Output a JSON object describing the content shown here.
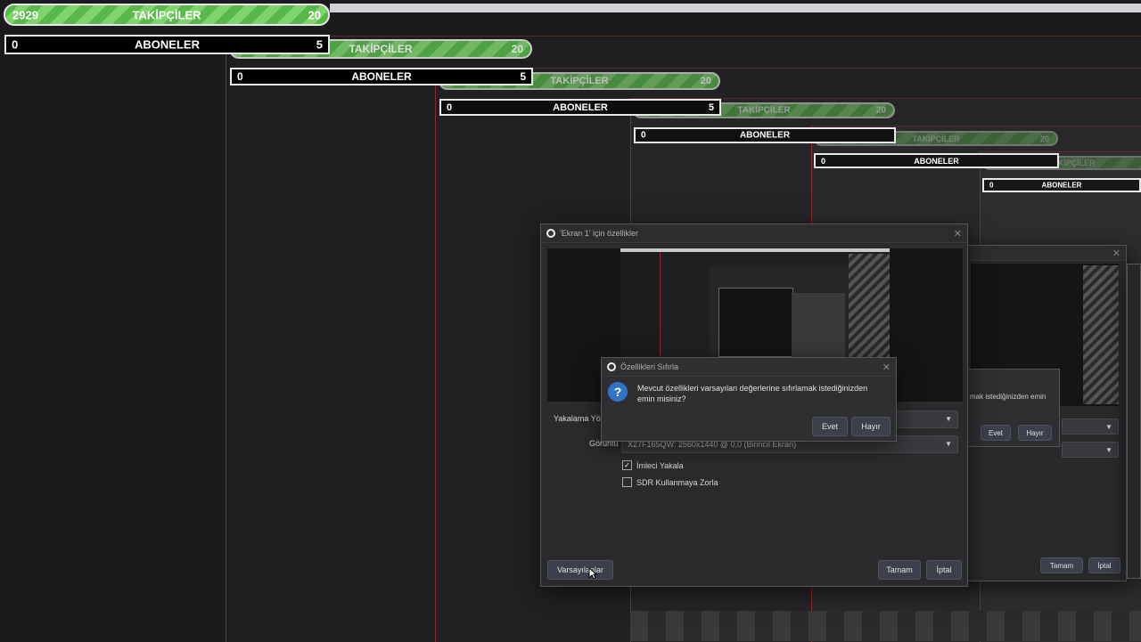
{
  "overlay": {
    "followers": {
      "current": "2929",
      "label": "TAKİPÇİLER",
      "goal": "20"
    },
    "subscribers": {
      "current": "0",
      "label": "ABONELER",
      "goal": "5"
    }
  },
  "properties_dialog": {
    "title": "'Ekran 1' için özellikler",
    "capture_method_label": "Yakalama Yön",
    "display_label": "Görüntü",
    "display_value": "X27F165QW: 2560x1440 @ 0,0 (Birincil Ekran)",
    "capture_cursor_label": "İmleci Yakala",
    "capture_cursor_checked": true,
    "force_sdr_label": "SDR Kullanmaya Zorla",
    "force_sdr_checked": false,
    "defaults_button": "Varsayılanlar",
    "ok_button": "Tamam",
    "cancel_button": "İptal"
  },
  "reset_dialog": {
    "title": "Özellikleri Sıfırla",
    "message": "Mevcut özellikleri varsayılan değerlerine sıfırlamak istediğinizden emin misiniz?",
    "yes_button": "Evet",
    "no_button": "Hayır"
  },
  "mirror_dialog": {
    "message_fragment": "mak istediğinizden emin",
    "yes_button": "Evet",
    "no_button": "Hayır",
    "ok_button": "Tamam",
    "cancel_button": "İptal"
  },
  "colors": {
    "progress_green": "#58b84a",
    "accent_red": "#8a2a2a",
    "dialog_bg": "#2b2b2e",
    "question_blue": "#2f73c9"
  }
}
